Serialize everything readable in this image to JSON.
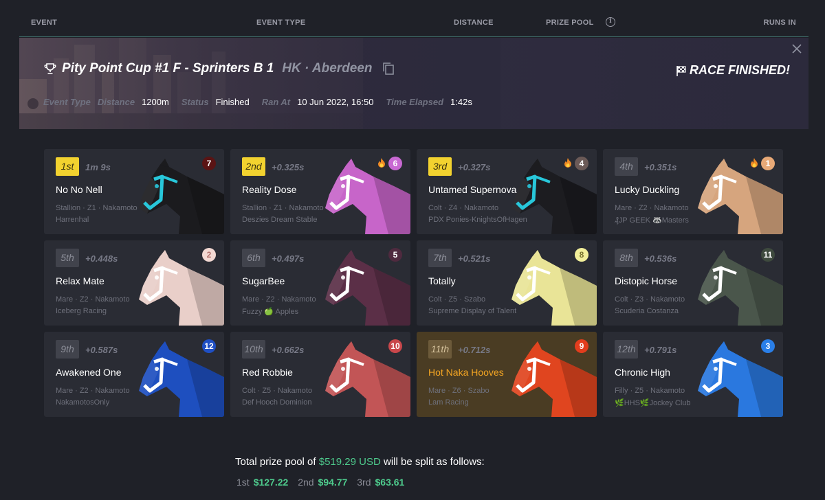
{
  "columns": {
    "event": "EVENT",
    "event_type": "EVENT TYPE",
    "distance": "DISTANCE",
    "prize_pool": "PRIZE POOL",
    "runs_in": "RUNS IN"
  },
  "banner": {
    "title": "Pity Point Cup #1 F - Sprinters B 1",
    "location": "HK · Aberdeen",
    "status_label": "RACE FINISHED!",
    "meta": {
      "event_type_label": "Event Type",
      "distance_label": "Distance",
      "distance_value": "1200m",
      "status_label": "Status",
      "status_value": "Finished",
      "ran_at_label": "Ran At",
      "ran_at_value": "10 Jun 2022, 16:50",
      "elapsed_label": "Time Elapsed",
      "elapsed_value": "1:42s"
    }
  },
  "results": [
    {
      "position": "1st",
      "time": "1m 9s",
      "name": "No No Nell",
      "specs": "Stallion · Z1 · Nakamoto",
      "stable": "Harrenhal",
      "number": "7",
      "num_bg": "#5a1414",
      "num_fg": "#ffffff",
      "coat": "#1b1b1e",
      "accent": "#28c7da",
      "flame": false
    },
    {
      "position": "2nd",
      "time": "+0.325s",
      "name": "Reality Dose",
      "specs": "Stallion · Z1 · Nakamoto",
      "stable": "Deszies Dream Stable",
      "number": "6",
      "num_bg": "#c969d3",
      "num_fg": "#ffffff",
      "coat": "#c765c9",
      "accent": "#ffffff",
      "flame": true
    },
    {
      "position": "3rd",
      "time": "+0.327s",
      "name": "Untamed Supernova",
      "specs": "Colt · Z4 · Nakamoto",
      "stable": "PDX Ponies-KnightsOfHagen",
      "number": "4",
      "num_bg": "#6b5a57",
      "num_fg": "#ffffff",
      "coat": "#1c1c20",
      "accent": "#28c7da",
      "flame": true
    },
    {
      "position": "4th",
      "time": "+0.351s",
      "name": "Lucky Duckling",
      "specs": "Mare · Z2 · Nakamoto",
      "stable": "₰JP GEEK 🦝Masters",
      "number": "1",
      "num_bg": "#e8a977",
      "num_fg": "#ffffff",
      "coat": "#d6a57e",
      "accent": "#ffffff",
      "flame": true
    },
    {
      "position": "5th",
      "time": "+0.448s",
      "name": "Relax Mate",
      "specs": "Mare · Z2 · Nakamoto",
      "stable": "Iceberg Racing",
      "number": "2",
      "num_bg": "#f3d9d3",
      "num_fg": "#b2706b",
      "coat": "#e9cfc9",
      "accent": "#ffffff",
      "flame": false
    },
    {
      "position": "6th",
      "time": "+0.497s",
      "name": "SugarBee",
      "specs": "Mare · Z2 · Nakamoto",
      "stable": "Fuzzy 🍏 Apples",
      "number": "5",
      "num_bg": "#4f2a3f",
      "num_fg": "#ffffff",
      "coat": "#5b2f47",
      "accent": "#ffffff",
      "flame": false
    },
    {
      "position": "7th",
      "time": "+0.521s",
      "name": "Totally",
      "specs": "Colt · Z5 · Szabo",
      "stable": "Supreme Display of Talent",
      "number": "8",
      "num_bg": "#f2ef9a",
      "num_fg": "#7a7430",
      "coat": "#e9e497",
      "accent": "#ffffff",
      "flame": false
    },
    {
      "position": "8th",
      "time": "+0.536s",
      "name": "Distopic Horse",
      "specs": "Colt · Z3 · Nakamoto",
      "stable": "Scuderia Costanza",
      "number": "11",
      "num_bg": "#3e4a3e",
      "num_fg": "#ffffff",
      "coat": "#4a564b",
      "accent": "#ffffff",
      "flame": false
    },
    {
      "position": "9th",
      "time": "+0.587s",
      "name": "Awakened One",
      "specs": "Mare · Z2 · Nakamoto",
      "stable": "NakamotosOnly",
      "number": "12",
      "num_bg": "#1f4fc4",
      "num_fg": "#ffffff",
      "coat": "#1e4fbf",
      "accent": "#ffffff",
      "flame": false
    },
    {
      "position": "10th",
      "time": "+0.662s",
      "name": "Red Robbie",
      "specs": "Colt · Z5 · Nakamoto",
      "stable": "Def Hooch Dominion",
      "number": "10",
      "num_bg": "#c9474b",
      "num_fg": "#ffffff",
      "coat": "#c25556",
      "accent": "#ffffff",
      "flame": false
    },
    {
      "position": "11th",
      "time": "+0.712s",
      "name": "Hot Naka Hooves",
      "specs": "Mare · Z6 · Szabo",
      "stable": "Lam Racing",
      "number": "9",
      "num_bg": "#e23d1d",
      "num_fg": "#ffffff",
      "coat": "#e0451f",
      "accent": "#ffffff",
      "flame": false
    },
    {
      "position": "12th",
      "time": "+0.791s",
      "name": "Chronic High",
      "specs": "Filly · Z5 · Nakamoto",
      "stable": "🌿HHS🌿Jockey Club",
      "number": "3",
      "num_bg": "#2a7fe8",
      "num_fg": "#ffffff",
      "coat": "#2a78df",
      "accent": "#ffffff",
      "flame": false
    }
  ],
  "prize": {
    "prefix": "Total prize pool of",
    "amount": "$519.29 USD",
    "suffix": "will be split as follows:",
    "split": [
      {
        "label": "1st",
        "value": "$127.22"
      },
      {
        "label": "2nd",
        "value": "$94.77"
      },
      {
        "label": "3rd",
        "value": "$63.61"
      }
    ]
  }
}
